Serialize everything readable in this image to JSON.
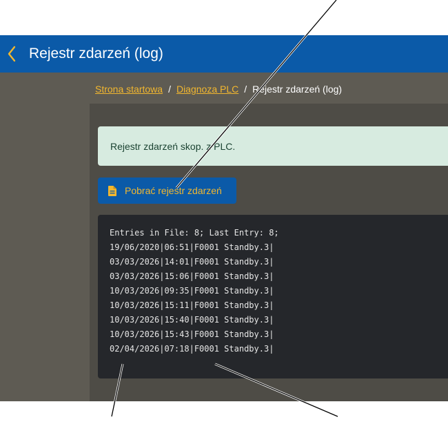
{
  "header": {
    "title": "Rejestr zdarzeń (log)"
  },
  "breadcrumb": {
    "items": [
      "Strona startowa",
      "Diagnoza PLC"
    ],
    "current": "Rejestr zdarzeń (log)",
    "separator": "/"
  },
  "alert": {
    "text": "Rejestr zdarzeń skop. z PLC."
  },
  "download_button": {
    "label": "Pobrać rejestr zdarzeń",
    "icon": "document-icon"
  },
  "log": {
    "lines": [
      "Entries in File: 8; Last Entry: 8;",
      "19/06/2020|06:51|F0001 Standby.3|",
      "03/03/2026|14:01|F0001 Standby.3|",
      "03/03/2026|15:06|F0001 Standby.3|",
      "10/03/2026|09:35|F0001 Standby.3|",
      "10/03/2026|15:11|F0001 Standby.3|",
      "10/03/2026|15:40|F0001 Standby.3|",
      "10/03/2026|15:43|F0001 Standby.3|",
      "02/04/2026|07:18|F0001 Standby.3|"
    ]
  },
  "colors": {
    "header_bg": "#0b5aa8",
    "accent": "#f2b72f",
    "content_bg": "#5e5b53",
    "alert_bg": "#d7ebe0",
    "log_bg": "#25272b"
  }
}
